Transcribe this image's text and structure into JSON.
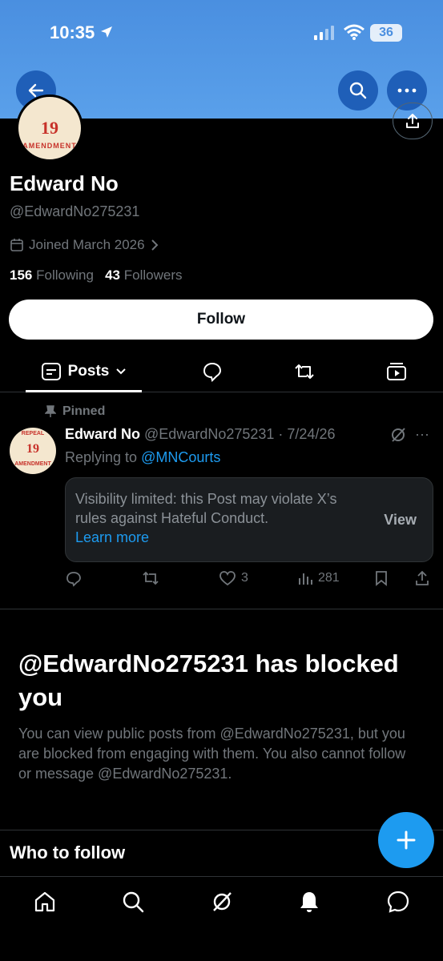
{
  "status_bar": {
    "time": "10:35",
    "battery": "36"
  },
  "profile": {
    "name": "Edward No",
    "handle": "@EdwardNo275231",
    "joined": "Joined March 2026",
    "following_count": "156",
    "following_label": "Following",
    "followers_count": "43",
    "followers_label": "Followers",
    "follow_button": "Follow",
    "avatar_text": {
      "number": "19",
      "superscript": "TH",
      "ring": "AMENDMENT",
      "top": "REPEAL",
      "mid": "THE"
    }
  },
  "tabs": {
    "posts": "Posts"
  },
  "pinned_post": {
    "pinned_label": "Pinned",
    "author_name": "Edward No",
    "author_meta": "@EdwardNo275231 · 7/24/26",
    "replying_prefix": "Replying to ",
    "replying_to": "@MNCourts",
    "notice_text": "Visibility limited: this Post may violate X’s rules against Hateful Conduct.",
    "learn_more": "Learn more",
    "view_label": "View",
    "likes": "3",
    "views": "281"
  },
  "blocked": {
    "title": "@EdwardNo275231 has blocked you",
    "text": "You can view public posts from @EdwardNo275231, but you are blocked from engaging with them. You also cannot follow or message @EdwardNo275231."
  },
  "who_to_follow": "Who to follow",
  "colors": {
    "accent": "#1d9bf0",
    "banner": "#5aa0ea",
    "background": "#000000"
  }
}
